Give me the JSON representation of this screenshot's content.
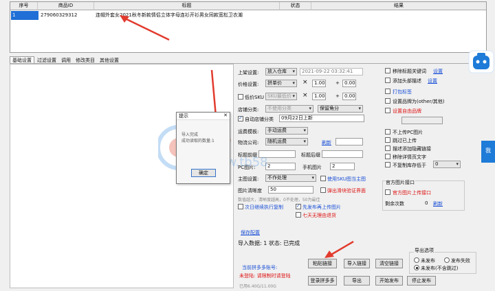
{
  "grid": {
    "headers": [
      "序号",
      "商品ID",
      "标题",
      "状态",
      "结果"
    ],
    "row": {
      "index": "1",
      "id": "279060329312",
      "title": "连帽外套女2021秋冬新款情侣立体字母连衫开衫男女同款宽松卫衣潮",
      "status": "",
      "result": ""
    }
  },
  "tabs": [
    "基础设置",
    "过滤设置",
    "调用",
    "修改类目",
    "其他设置"
  ],
  "settings": {
    "listing_label": "上架设置:",
    "listing_value": "放入仓库",
    "datetime": "2021-09-22 03:32:41",
    "price_label": "价格设置:",
    "price_value": "拼单价",
    "price_mult": "1.00",
    "price_plus": "0.00",
    "lowprice_label": "低价SKU",
    "lowprice_value": "SKU最低价",
    "lowprice_mult": "1.00",
    "lowprice_plus": "0.00",
    "category_label": "店铺分类:",
    "category_value": "不使用分类",
    "keep_value": "保留角分",
    "auto_category_label": "自动店铺分类",
    "auto_category_value": "09月22日上新",
    "ship_label": "运费模板:",
    "ship_value": "手动运费",
    "refresh": "刷新",
    "express_label": "物流公司:",
    "express_value": "随机运费",
    "title_prefix_label": "标题前缀",
    "title_suffix_label": "标题后缀",
    "pc_img_label": "PC图片:",
    "pc_img_value": "2",
    "mobile_img_label": "手机图片",
    "mobile_img_value": "2",
    "main_img_label": "主图设置:",
    "main_img_value": "不作处理",
    "sku_main_label": "使用SKU图当主图",
    "clarity_label": "图片清晰度",
    "clarity_value": "50",
    "captcha_label": "弹出滑块验证界面",
    "clarity_hint": "数值越大，清晰度越高，0不处理，50为最佳",
    "next_day_label": "次日继续执行复制",
    "publish_first_label": "先发布再上传图片",
    "seven_day_label": "七天无理由退货",
    "save_config": "保存配置",
    "import_status": "导入数据: 1 状态: 已完成",
    "account_label": "当前拼多多账号:",
    "login_status": "未登陆: 请限制时请登陆",
    "usage": "已用6.40G/11.00G"
  },
  "options": {
    "remove_keyword": "移除标题关键词",
    "remove_keyword_link": "设置",
    "add_head": "添加头部描述",
    "add_head_link": "设置",
    "tag": "打包标签",
    "brand_other": "设置品牌为(other/其他)",
    "custom_brand": "设置自由品牌",
    "no_pc": "不上传PC图片",
    "skip_published": "跳过已上传",
    "desc_tag": "描述添加隐藏链接",
    "remove_detail": "移除详情页文字",
    "stock_label": "不复制库存低于",
    "stock_value": "0"
  },
  "official": {
    "group_title": "官方图片接口",
    "upload_label": "官方图片上传接口",
    "remaining_label": "剩余次数",
    "remaining_value": "0",
    "refresh": "刷新"
  },
  "export": {
    "group_title": "导出选项",
    "opt1": "未发布",
    "opt2": "发布失败",
    "opt3": "未发布(不含跳过)"
  },
  "buttons": {
    "paste": "粘贴链接",
    "import": "导入链接",
    "clear": "清空链接",
    "login": "登录拼多多",
    "export": "导出",
    "start": "开始发布",
    "stop": "停止发布"
  },
  "dialog": {
    "title": "提示",
    "line1": "导入完成",
    "line2": "成功读取的数量:1",
    "ok": "确定"
  },
  "side": {
    "tab_text": "我"
  },
  "colors": {
    "selection": "#1f6fd6",
    "link": "#1a4fd6",
    "warning": "#d11111",
    "arrow": "#e23b2e"
  }
}
